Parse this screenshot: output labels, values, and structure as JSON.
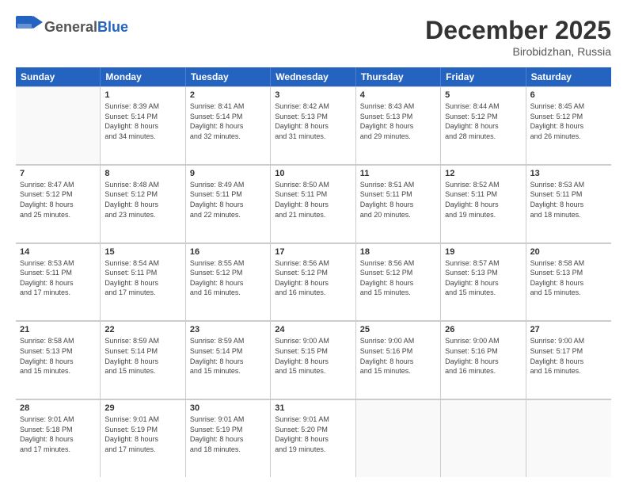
{
  "header": {
    "logo_general": "General",
    "logo_blue": "Blue",
    "month_title": "December 2025",
    "location": "Birobidzhan, Russia"
  },
  "weekdays": [
    "Sunday",
    "Monday",
    "Tuesday",
    "Wednesday",
    "Thursday",
    "Friday",
    "Saturday"
  ],
  "rows": [
    [
      {
        "day": "",
        "sunrise": "",
        "sunset": "",
        "daylight": ""
      },
      {
        "day": "1",
        "sunrise": "Sunrise: 8:39 AM",
        "sunset": "Sunset: 5:14 PM",
        "daylight": "Daylight: 8 hours and 34 minutes."
      },
      {
        "day": "2",
        "sunrise": "Sunrise: 8:41 AM",
        "sunset": "Sunset: 5:14 PM",
        "daylight": "Daylight: 8 hours and 32 minutes."
      },
      {
        "day": "3",
        "sunrise": "Sunrise: 8:42 AM",
        "sunset": "Sunset: 5:13 PM",
        "daylight": "Daylight: 8 hours and 31 minutes."
      },
      {
        "day": "4",
        "sunrise": "Sunrise: 8:43 AM",
        "sunset": "Sunset: 5:13 PM",
        "daylight": "Daylight: 8 hours and 29 minutes."
      },
      {
        "day": "5",
        "sunrise": "Sunrise: 8:44 AM",
        "sunset": "Sunset: 5:12 PM",
        "daylight": "Daylight: 8 hours and 28 minutes."
      },
      {
        "day": "6",
        "sunrise": "Sunrise: 8:45 AM",
        "sunset": "Sunset: 5:12 PM",
        "daylight": "Daylight: 8 hours and 26 minutes."
      }
    ],
    [
      {
        "day": "7",
        "sunrise": "Sunrise: 8:47 AM",
        "sunset": "Sunset: 5:12 PM",
        "daylight": "Daylight: 8 hours and 25 minutes."
      },
      {
        "day": "8",
        "sunrise": "Sunrise: 8:48 AM",
        "sunset": "Sunset: 5:12 PM",
        "daylight": "Daylight: 8 hours and 23 minutes."
      },
      {
        "day": "9",
        "sunrise": "Sunrise: 8:49 AM",
        "sunset": "Sunset: 5:11 PM",
        "daylight": "Daylight: 8 hours and 22 minutes."
      },
      {
        "day": "10",
        "sunrise": "Sunrise: 8:50 AM",
        "sunset": "Sunset: 5:11 PM",
        "daylight": "Daylight: 8 hours and 21 minutes."
      },
      {
        "day": "11",
        "sunrise": "Sunrise: 8:51 AM",
        "sunset": "Sunset: 5:11 PM",
        "daylight": "Daylight: 8 hours and 20 minutes."
      },
      {
        "day": "12",
        "sunrise": "Sunrise: 8:52 AM",
        "sunset": "Sunset: 5:11 PM",
        "daylight": "Daylight: 8 hours and 19 minutes."
      },
      {
        "day": "13",
        "sunrise": "Sunrise: 8:53 AM",
        "sunset": "Sunset: 5:11 PM",
        "daylight": "Daylight: 8 hours and 18 minutes."
      }
    ],
    [
      {
        "day": "14",
        "sunrise": "Sunrise: 8:53 AM",
        "sunset": "Sunset: 5:11 PM",
        "daylight": "Daylight: 8 hours and 17 minutes."
      },
      {
        "day": "15",
        "sunrise": "Sunrise: 8:54 AM",
        "sunset": "Sunset: 5:11 PM",
        "daylight": "Daylight: 8 hours and 17 minutes."
      },
      {
        "day": "16",
        "sunrise": "Sunrise: 8:55 AM",
        "sunset": "Sunset: 5:12 PM",
        "daylight": "Daylight: 8 hours and 16 minutes."
      },
      {
        "day": "17",
        "sunrise": "Sunrise: 8:56 AM",
        "sunset": "Sunset: 5:12 PM",
        "daylight": "Daylight: 8 hours and 16 minutes."
      },
      {
        "day": "18",
        "sunrise": "Sunrise: 8:56 AM",
        "sunset": "Sunset: 5:12 PM",
        "daylight": "Daylight: 8 hours and 15 minutes."
      },
      {
        "day": "19",
        "sunrise": "Sunrise: 8:57 AM",
        "sunset": "Sunset: 5:13 PM",
        "daylight": "Daylight: 8 hours and 15 minutes."
      },
      {
        "day": "20",
        "sunrise": "Sunrise: 8:58 AM",
        "sunset": "Sunset: 5:13 PM",
        "daylight": "Daylight: 8 hours and 15 minutes."
      }
    ],
    [
      {
        "day": "21",
        "sunrise": "Sunrise: 8:58 AM",
        "sunset": "Sunset: 5:13 PM",
        "daylight": "Daylight: 8 hours and 15 minutes."
      },
      {
        "day": "22",
        "sunrise": "Sunrise: 8:59 AM",
        "sunset": "Sunset: 5:14 PM",
        "daylight": "Daylight: 8 hours and 15 minutes."
      },
      {
        "day": "23",
        "sunrise": "Sunrise: 8:59 AM",
        "sunset": "Sunset: 5:14 PM",
        "daylight": "Daylight: 8 hours and 15 minutes."
      },
      {
        "day": "24",
        "sunrise": "Sunrise: 9:00 AM",
        "sunset": "Sunset: 5:15 PM",
        "daylight": "Daylight: 8 hours and 15 minutes."
      },
      {
        "day": "25",
        "sunrise": "Sunrise: 9:00 AM",
        "sunset": "Sunset: 5:16 PM",
        "daylight": "Daylight: 8 hours and 15 minutes."
      },
      {
        "day": "26",
        "sunrise": "Sunrise: 9:00 AM",
        "sunset": "Sunset: 5:16 PM",
        "daylight": "Daylight: 8 hours and 16 minutes."
      },
      {
        "day": "27",
        "sunrise": "Sunrise: 9:00 AM",
        "sunset": "Sunset: 5:17 PM",
        "daylight": "Daylight: 8 hours and 16 minutes."
      }
    ],
    [
      {
        "day": "28",
        "sunrise": "Sunrise: 9:01 AM",
        "sunset": "Sunset: 5:18 PM",
        "daylight": "Daylight: 8 hours and 17 minutes."
      },
      {
        "day": "29",
        "sunrise": "Sunrise: 9:01 AM",
        "sunset": "Sunset: 5:19 PM",
        "daylight": "Daylight: 8 hours and 17 minutes."
      },
      {
        "day": "30",
        "sunrise": "Sunrise: 9:01 AM",
        "sunset": "Sunset: 5:19 PM",
        "daylight": "Daylight: 8 hours and 18 minutes."
      },
      {
        "day": "31",
        "sunrise": "Sunrise: 9:01 AM",
        "sunset": "Sunset: 5:20 PM",
        "daylight": "Daylight: 8 hours and 19 minutes."
      },
      {
        "day": "",
        "sunrise": "",
        "sunset": "",
        "daylight": ""
      },
      {
        "day": "",
        "sunrise": "",
        "sunset": "",
        "daylight": ""
      },
      {
        "day": "",
        "sunrise": "",
        "sunset": "",
        "daylight": ""
      }
    ]
  ]
}
